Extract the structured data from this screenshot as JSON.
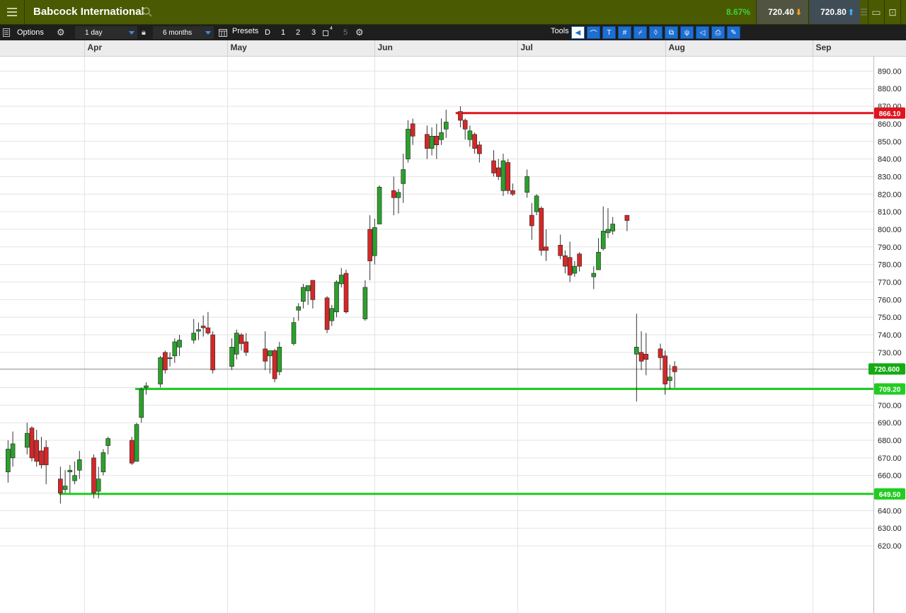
{
  "header": {
    "title": "Babcock International",
    "change_pct": "8.67%",
    "sell_price": "720.40",
    "buy_price": "720.80"
  },
  "toolbar": {
    "options_label": "Options",
    "interval": "1 day",
    "range": "6 months",
    "presets_label": "Presets",
    "preset_d": "D",
    "preset_1": "1",
    "preset_2": "2",
    "preset_3": "3",
    "preset_4_sup": "4",
    "preset_5": "5",
    "tools_label": "Tools"
  },
  "colors": {
    "up": "#2ca02c",
    "down": "#d62728",
    "resistance": "#e0141e",
    "support": "#22cc22",
    "current": "#14aa14"
  },
  "chart_data": {
    "type": "candlestick",
    "title": "Babcock International",
    "interval": "1 day",
    "ylim": [
      615,
      895
    ],
    "y_ticks": [
      "890.00",
      "880.00",
      "870.00",
      "860.00",
      "850.00",
      "840.00",
      "830.00",
      "820.00",
      "810.00",
      "800.00",
      "790.00",
      "780.00",
      "770.00",
      "760.00",
      "750.00",
      "740.00",
      "730.00",
      "720.00",
      "710.00",
      "700.00",
      "690.00",
      "680.00",
      "670.00",
      "660.00",
      "650.00",
      "640.00",
      "630.00",
      "620.00"
    ],
    "x_labels": [
      "Apr",
      "May",
      "Jun",
      "Jul",
      "Aug",
      "Sep"
    ],
    "grid": true,
    "horizontal_lines": [
      {
        "value": 866.1,
        "label": "866.10",
        "kind": "resistance"
      },
      {
        "value": 709.2,
        "label": "709.20",
        "kind": "support"
      },
      {
        "value": 649.5,
        "label": "649.50",
        "kind": "support"
      }
    ],
    "current_price": {
      "value": 720.6,
      "label": "720.600"
    },
    "candles": [
      {
        "date": "2023-03-16",
        "o": 662,
        "h": 680,
        "l": 656,
        "c": 675
      },
      {
        "date": "2023-03-17",
        "o": 670,
        "h": 685,
        "l": 665,
        "c": 678
      },
      {
        "date": "2023-03-20",
        "o": 676,
        "h": 690,
        "l": 672,
        "c": 684
      },
      {
        "date": "2023-03-21",
        "o": 687,
        "h": 688,
        "l": 668,
        "c": 670
      },
      {
        "date": "2023-03-22",
        "o": 680,
        "h": 686,
        "l": 665,
        "c": 668
      },
      {
        "date": "2023-03-23",
        "o": 674,
        "h": 682,
        "l": 664,
        "c": 666
      },
      {
        "date": "2023-03-24",
        "o": 676,
        "h": 680,
        "l": 655,
        "c": 666
      },
      {
        "date": "2023-03-27",
        "o": 658,
        "h": 665,
        "l": 644,
        "c": 650
      },
      {
        "date": "2023-03-28",
        "o": 652,
        "h": 663,
        "l": 650,
        "c": 654
      },
      {
        "date": "2023-03-29",
        "o": 662,
        "h": 666,
        "l": 650,
        "c": 663
      },
      {
        "date": "2023-03-30",
        "o": 657,
        "h": 668,
        "l": 655,
        "c": 660
      },
      {
        "date": "2023-03-31",
        "o": 663,
        "h": 674,
        "l": 658,
        "c": 669
      },
      {
        "date": "2023-04-03",
        "o": 670,
        "h": 672,
        "l": 647,
        "c": 650
      },
      {
        "date": "2023-04-04",
        "o": 651,
        "h": 665,
        "l": 647,
        "c": 658
      },
      {
        "date": "2023-04-05",
        "o": 662,
        "h": 675,
        "l": 660,
        "c": 673
      },
      {
        "date": "2023-04-06",
        "o": 677,
        "h": 682,
        "l": 672,
        "c": 681
      },
      {
        "date": "2023-04-11",
        "o": 680,
        "h": 682,
        "l": 666,
        "c": 667
      },
      {
        "date": "2023-04-12",
        "o": 668,
        "h": 690,
        "l": 668,
        "c": 689
      },
      {
        "date": "2023-04-13",
        "o": 693,
        "h": 710,
        "l": 690,
        "c": 709
      },
      {
        "date": "2023-04-14",
        "o": 710,
        "h": 713,
        "l": 706,
        "c": 711
      },
      {
        "date": "2023-04-17",
        "o": 712,
        "h": 728,
        "l": 710,
        "c": 727
      },
      {
        "date": "2023-04-18",
        "o": 730,
        "h": 731,
        "l": 718,
        "c": 720
      },
      {
        "date": "2023-04-19",
        "o": 727,
        "h": 730,
        "l": 722,
        "c": 727
      },
      {
        "date": "2023-04-20",
        "o": 728,
        "h": 738,
        "l": 724,
        "c": 736
      },
      {
        "date": "2023-04-21",
        "o": 733,
        "h": 740,
        "l": 728,
        "c": 737
      },
      {
        "date": "2023-04-24",
        "o": 737,
        "h": 749,
        "l": 735,
        "c": 741
      },
      {
        "date": "2023-04-25",
        "o": 742,
        "h": 747,
        "l": 737,
        "c": 743
      },
      {
        "date": "2023-04-26",
        "o": 745,
        "h": 751,
        "l": 739,
        "c": 744
      },
      {
        "date": "2023-04-27",
        "o": 744,
        "h": 753,
        "l": 740,
        "c": 741
      },
      {
        "date": "2023-04-28",
        "o": 740,
        "h": 742,
        "l": 718,
        "c": 720
      },
      {
        "date": "2023-05-02",
        "o": 722,
        "h": 738,
        "l": 720,
        "c": 733
      },
      {
        "date": "2023-05-03",
        "o": 729,
        "h": 743,
        "l": 726,
        "c": 741
      },
      {
        "date": "2023-05-04",
        "o": 740,
        "h": 741,
        "l": 731,
        "c": 735
      },
      {
        "date": "2023-05-05",
        "o": 736,
        "h": 741,
        "l": 728,
        "c": 730
      },
      {
        "date": "2023-05-09",
        "o": 732,
        "h": 742,
        "l": 720,
        "c": 725
      },
      {
        "date": "2023-05-10",
        "o": 728,
        "h": 731,
        "l": 718,
        "c": 731
      },
      {
        "date": "2023-05-11",
        "o": 731,
        "h": 732,
        "l": 713,
        "c": 715
      },
      {
        "date": "2023-05-12",
        "o": 719,
        "h": 736,
        "l": 717,
        "c": 733
      },
      {
        "date": "2023-05-15",
        "o": 735,
        "h": 750,
        "l": 734,
        "c": 747
      },
      {
        "date": "2023-05-16",
        "o": 754,
        "h": 758,
        "l": 748,
        "c": 756
      },
      {
        "date": "2023-05-17",
        "o": 759,
        "h": 769,
        "l": 755,
        "c": 767
      },
      {
        "date": "2023-05-18",
        "o": 765,
        "h": 767,
        "l": 757,
        "c": 768
      },
      {
        "date": "2023-05-19",
        "o": 771,
        "h": 770,
        "l": 755,
        "c": 760
      },
      {
        "date": "2023-05-22",
        "o": 761,
        "h": 762,
        "l": 741,
        "c": 743
      },
      {
        "date": "2023-05-23",
        "o": 748,
        "h": 757,
        "l": 745,
        "c": 755
      },
      {
        "date": "2023-05-24",
        "o": 753,
        "h": 771,
        "l": 750,
        "c": 770
      },
      {
        "date": "2023-05-25",
        "o": 769,
        "h": 778,
        "l": 767,
        "c": 774
      },
      {
        "date": "2023-05-26",
        "o": 775,
        "h": 777,
        "l": 752,
        "c": 753
      },
      {
        "date": "2023-05-30",
        "o": 749,
        "h": 771,
        "l": 748,
        "c": 767
      },
      {
        "date": "2023-05-31",
        "o": 800,
        "h": 808,
        "l": 771,
        "c": 782
      },
      {
        "date": "2023-06-01",
        "o": 785,
        "h": 806,
        "l": 780,
        "c": 801
      },
      {
        "date": "2023-06-02",
        "o": 803,
        "h": 825,
        "l": 803,
        "c": 824
      },
      {
        "date": "2023-06-05",
        "o": 822,
        "h": 830,
        "l": 808,
        "c": 818
      },
      {
        "date": "2023-06-06",
        "o": 818,
        "h": 823,
        "l": 809,
        "c": 821
      },
      {
        "date": "2023-06-07",
        "o": 826,
        "h": 843,
        "l": 815,
        "c": 834
      },
      {
        "date": "2023-06-08",
        "o": 840,
        "h": 862,
        "l": 838,
        "c": 857
      },
      {
        "date": "2023-06-09",
        "o": 860,
        "h": 863,
        "l": 848,
        "c": 853
      },
      {
        "date": "2023-06-12",
        "o": 854,
        "h": 859,
        "l": 840,
        "c": 846
      },
      {
        "date": "2023-06-13",
        "o": 846,
        "h": 858,
        "l": 842,
        "c": 853
      },
      {
        "date": "2023-06-14",
        "o": 853,
        "h": 860,
        "l": 840,
        "c": 848
      },
      {
        "date": "2023-06-15",
        "o": 851,
        "h": 863,
        "l": 848,
        "c": 855
      },
      {
        "date": "2023-06-16",
        "o": 857,
        "h": 868,
        "l": 852,
        "c": 861
      },
      {
        "date": "2023-06-19",
        "o": 867,
        "h": 870,
        "l": 858,
        "c": 862
      },
      {
        "date": "2023-06-20",
        "o": 862,
        "h": 863,
        "l": 851,
        "c": 857
      },
      {
        "date": "2023-06-21",
        "o": 851,
        "h": 859,
        "l": 847,
        "c": 856
      },
      {
        "date": "2023-06-22",
        "o": 854,
        "h": 855,
        "l": 843,
        "c": 846
      },
      {
        "date": "2023-06-23",
        "o": 848,
        "h": 850,
        "l": 838,
        "c": 843
      },
      {
        "date": "2023-06-26",
        "o": 839,
        "h": 845,
        "l": 830,
        "c": 832
      },
      {
        "date": "2023-06-27",
        "o": 835,
        "h": 840,
        "l": 828,
        "c": 830
      },
      {
        "date": "2023-06-28",
        "o": 822,
        "h": 843,
        "l": 819,
        "c": 839
      },
      {
        "date": "2023-06-29",
        "o": 838,
        "h": 840,
        "l": 820,
        "c": 822
      },
      {
        "date": "2023-06-30",
        "o": 822,
        "h": 826,
        "l": 819,
        "c": 820
      },
      {
        "date": "2023-07-03",
        "o": 821,
        "h": 834,
        "l": 818,
        "c": 830
      },
      {
        "date": "2023-07-04",
        "o": 808,
        "h": 815,
        "l": 794,
        "c": 802
      },
      {
        "date": "2023-07-05",
        "o": 810,
        "h": 820,
        "l": 808,
        "c": 819
      },
      {
        "date": "2023-07-06",
        "o": 812,
        "h": 813,
        "l": 785,
        "c": 788
      },
      {
        "date": "2023-07-07",
        "o": 790,
        "h": 800,
        "l": 782,
        "c": 788
      },
      {
        "date": "2023-07-10",
        "o": 791,
        "h": 797,
        "l": 783,
        "c": 785
      },
      {
        "date": "2023-07-11",
        "o": 785,
        "h": 788,
        "l": 775,
        "c": 779
      },
      {
        "date": "2023-07-12",
        "o": 784,
        "h": 793,
        "l": 770,
        "c": 774
      },
      {
        "date": "2023-07-13",
        "o": 775,
        "h": 782,
        "l": 773,
        "c": 779
      },
      {
        "date": "2023-07-14",
        "o": 786,
        "h": 787,
        "l": 776,
        "c": 779
      },
      {
        "date": "2023-07-17",
        "o": 773,
        "h": 779,
        "l": 766,
        "c": 775
      },
      {
        "date": "2023-07-18",
        "o": 777,
        "h": 795,
        "l": 777,
        "c": 787
      },
      {
        "date": "2023-07-19",
        "o": 789,
        "h": 813,
        "l": 788,
        "c": 799
      },
      {
        "date": "2023-07-20",
        "o": 798,
        "h": 812,
        "l": 795,
        "c": 800
      },
      {
        "date": "2023-07-21",
        "o": 799,
        "h": 807,
        "l": 797,
        "c": 803
      },
      {
        "date": "2023-07-24",
        "o": 808,
        "h": 808,
        "l": 799,
        "c": 805
      },
      {
        "date": "2023-07-26",
        "o": 729,
        "h": 752,
        "l": 702,
        "c": 733
      },
      {
        "date": "2023-07-27",
        "o": 730,
        "h": 742,
        "l": 720,
        "c": 725
      },
      {
        "date": "2023-07-28",
        "o": 729,
        "h": 741,
        "l": 717,
        "c": 726
      },
      {
        "date": "2023-07-31",
        "o": 732,
        "h": 735,
        "l": 720,
        "c": 727
      },
      {
        "date": "2023-08-01",
        "o": 728,
        "h": 731,
        "l": 706,
        "c": 712
      },
      {
        "date": "2023-08-02",
        "o": 714,
        "h": 723,
        "l": 709,
        "c": 716
      },
      {
        "date": "2023-08-03",
        "o": 722,
        "h": 725,
        "l": 710,
        "c": 719
      }
    ]
  }
}
